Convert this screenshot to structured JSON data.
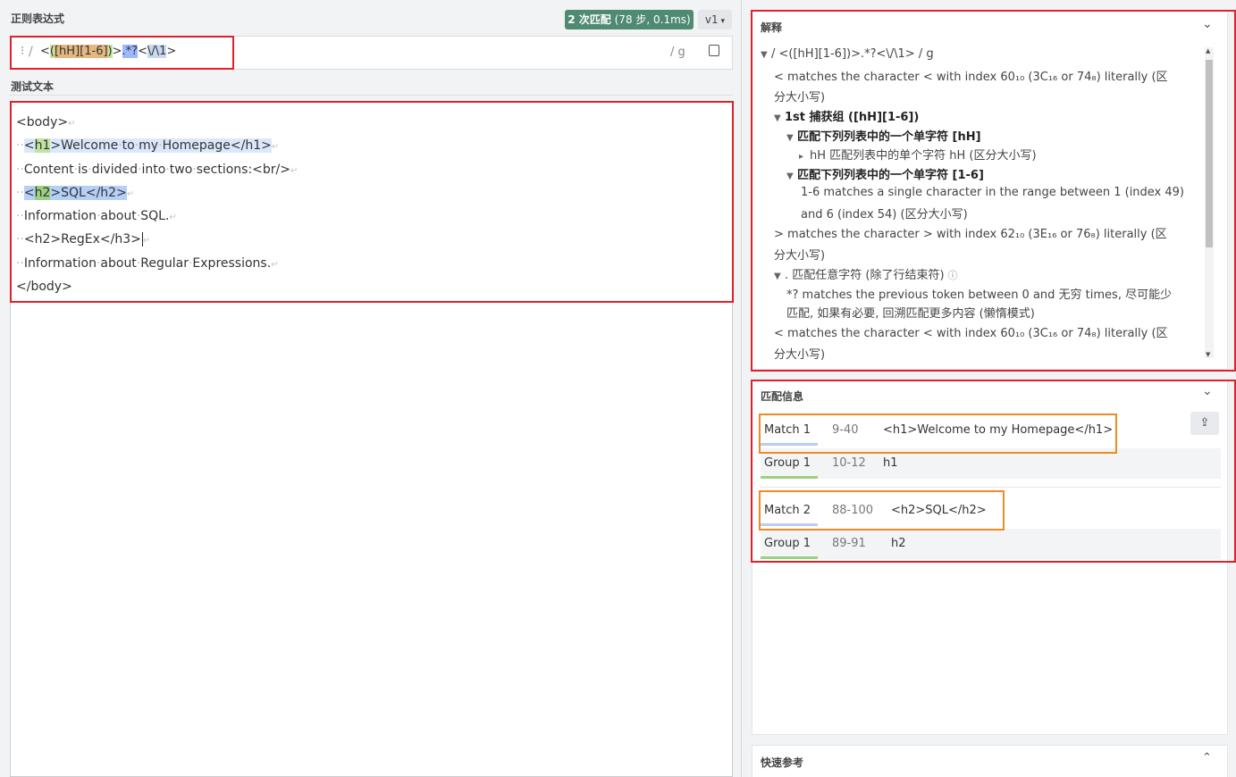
{
  "regex_panel": {
    "title": "正则表达式",
    "match_badge": "2 次匹配",
    "match_stats": "(78 步, 0.1ms)",
    "version": "v1",
    "delimiter_open": "/",
    "pattern_tokens": [
      "<",
      "(",
      "[hH]",
      "[1-6]",
      ")",
      ">",
      ".*?",
      "<",
      "\\/",
      "\\1",
      ">"
    ],
    "flags": "/ g"
  },
  "test_panel": {
    "title": "测试文本",
    "lines": [
      "<body>",
      "  <h1>Welcome to my Homepage</h1>",
      "  Content is divided into two sections:<br/>",
      "  <h2>SQL</h2>",
      "  Information about SQL.",
      "  <h2>RegEx</h3>",
      "  Information about Regular Expressions.",
      "</body>"
    ]
  },
  "explanation": {
    "title": "解释",
    "header_pattern": "/ <([hH][1-6])>.*?<\\/\\1> / g",
    "lines": [
      "< matches the character < with index 60₁₀ (3C₁₆ or 74₈) literally (区",
      "分大小写)",
      "1st 捕获组 ([hH][1-6])",
      "匹配下列列表中的一个单字符 [hH]",
      "hH 匹配列表中的单个字符 hH (区分大小写)",
      "匹配下列列表中的一个单字符 [1-6]",
      "1-6 matches a single character in the range between 1 (index 49)",
      "and 6 (index 54) (区分大小写)",
      "> matches the character > with index 62₁₀ (3E₁₆ or 76₈) literally (区",
      "分大小写)",
      ". 匹配任意字符 (除了行结束符)",
      "*? matches the previous token between 0 and 无穷 times, 尽可能少",
      "匹配, 如果有必要, 回溯匹配更多内容 (懒惰模式)",
      "< matches the character < with index 60₁₀ (3C₁₆ or 74₈) literally (区",
      "分大小写)"
    ]
  },
  "match_info": {
    "title": "匹配信息",
    "matches": [
      {
        "label": "Match 1",
        "range": "9-40",
        "value": "<h1>Welcome to my Homepage</h1>",
        "group_label": "Group 1",
        "group_range": "10-12",
        "group_value": "h1"
      },
      {
        "label": "Match 2",
        "range": "88-100",
        "value": "<h2>SQL</h2>",
        "group_label": "Group 1",
        "group_range": "89-91",
        "group_value": "h2"
      }
    ]
  },
  "quick_ref": {
    "title": "快速参考"
  },
  "colors": {
    "highlight_red": "#e0202a",
    "highlight_orange": "#f08a24",
    "match_blue": "#b5cff7",
    "group_green": "#9cd081",
    "badge_green": "#4f8a72"
  }
}
